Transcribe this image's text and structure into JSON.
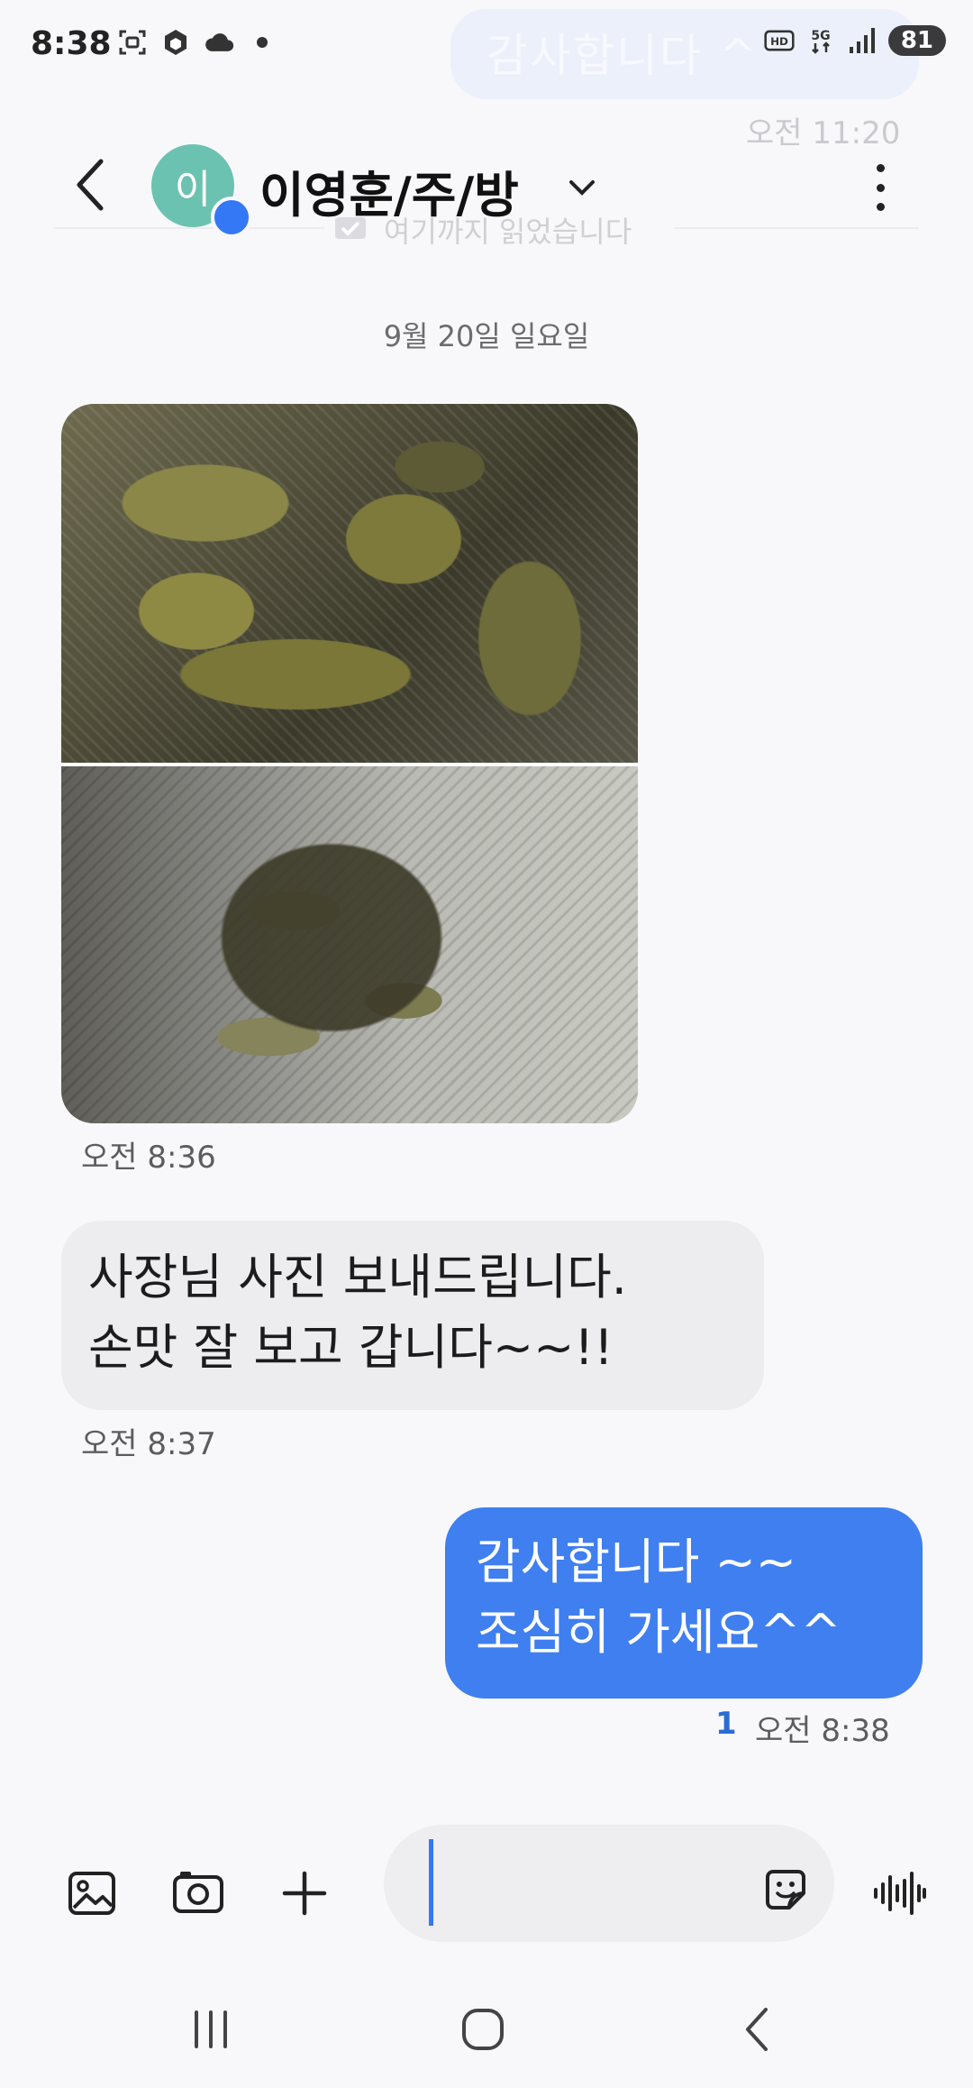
{
  "status_bar": {
    "time": "8:38",
    "battery": "81",
    "network": "5G"
  },
  "ghost": {
    "bubble_text": "감사합니다 ^^",
    "time": "오전 11:20",
    "read_marker": "여기까지 읽었습니다"
  },
  "header": {
    "avatar_initial": "이",
    "contact_name": "이영훈/주/방"
  },
  "date_separator": "9월 20일 일요일",
  "messages": [
    {
      "type": "image",
      "time": "오전 8:36"
    },
    {
      "type": "received",
      "lines": [
        "사장님 사진 보내드립니다.",
        "손맛 잘 보고 갑니다~~!!"
      ],
      "time": "오전 8:37"
    },
    {
      "type": "sent",
      "lines": [
        "감사합니다 ~~",
        "조심히 가세요^^"
      ],
      "unread": "1",
      "time": "오전 8:38"
    }
  ],
  "composer": {
    "placeholder": ""
  },
  "colors": {
    "sent_bubble": "#3f7ff0",
    "received_bubble": "#ededef",
    "accent": "#3478f6",
    "avatar": "#6cc2b0"
  }
}
